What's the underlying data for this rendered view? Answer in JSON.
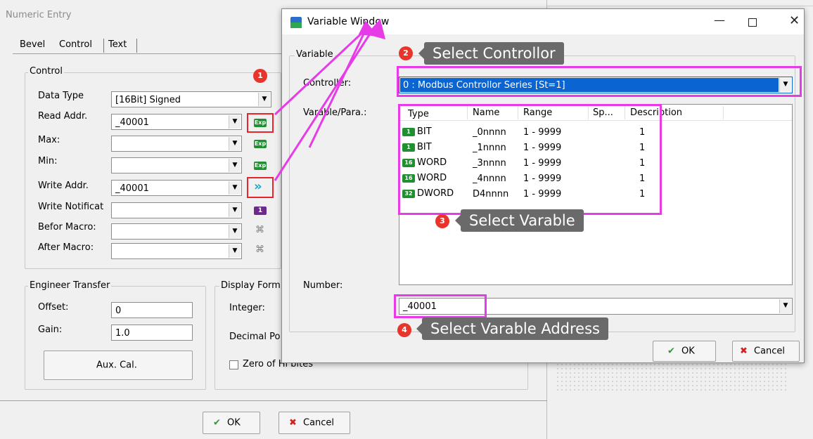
{
  "numeric_entry": {
    "title": "Numeric Entry",
    "tabs": [
      "Bevel",
      "Control",
      "Text"
    ],
    "control_group_label": "Control",
    "fields": {
      "data_type_label": "Data Type",
      "data_type_value": "[16Bit] Signed",
      "read_addr_label": "Read Addr.",
      "read_addr_value": "_40001",
      "max_label": "Max:",
      "min_label": "Min:",
      "write_addr_label": "Write Addr.",
      "write_addr_value": "_40001",
      "write_notif_label": "Write Notificat",
      "before_macro_label": "Befor Macro:",
      "after_macro_label": "After Macro:"
    },
    "engineer_transfer": {
      "label": "Engineer Transfer",
      "offset_label": "Offset:",
      "offset_value": "0",
      "gain_label": "Gain:",
      "gain_value": "1.0",
      "aux_button": "Aux. Cal."
    },
    "display_format": {
      "label": "Display Form",
      "integer_label": "Integer:",
      "decimal_label": "Decimal Po",
      "zero_label": "Zero of Hi bites"
    },
    "ok_label": "OK",
    "cancel_label": "Cancel"
  },
  "variable_window": {
    "title": "Variable Window",
    "variable_group_label": "Variable",
    "controller_label": "Controller:",
    "controller_value": "0 : Modbus Controllor Series [St=1]",
    "varpara_label": "Varable/Para.:",
    "columns": [
      "Type",
      "Name",
      "Range",
      "Sp...",
      "Description"
    ],
    "rows": [
      {
        "icon": "1",
        "type": "BIT",
        "name": "_0nnnn",
        "range": "1 - 9999",
        "sp": "1"
      },
      {
        "icon": "1",
        "type": "BIT",
        "name": "_1nnnn",
        "range": "1 - 9999",
        "sp": "1"
      },
      {
        "icon": "16",
        "type": "WORD",
        "name": "_3nnnn",
        "range": "1 - 9999",
        "sp": "1"
      },
      {
        "icon": "16",
        "type": "WORD",
        "name": "_4nnnn",
        "range": "1 - 9999",
        "sp": "1"
      },
      {
        "icon": "32",
        "type": "DWORD",
        "name": "D4nnnn",
        "range": "1 - 9999",
        "sp": "1"
      }
    ],
    "number_label": "Number:",
    "number_value": "_40001",
    "ok_label": "OK",
    "cancel_label": "Cancel"
  },
  "annotations": {
    "marker1": "1",
    "marker2": "2",
    "marker3": "3",
    "marker4": "4",
    "callout2": "Select Controllor",
    "callout3": "Select Varable",
    "callout4": "Select Varable Address"
  },
  "colors": {
    "highlight": "#e63be6",
    "marker": "#e8342a",
    "selection": "#0a64d2"
  }
}
